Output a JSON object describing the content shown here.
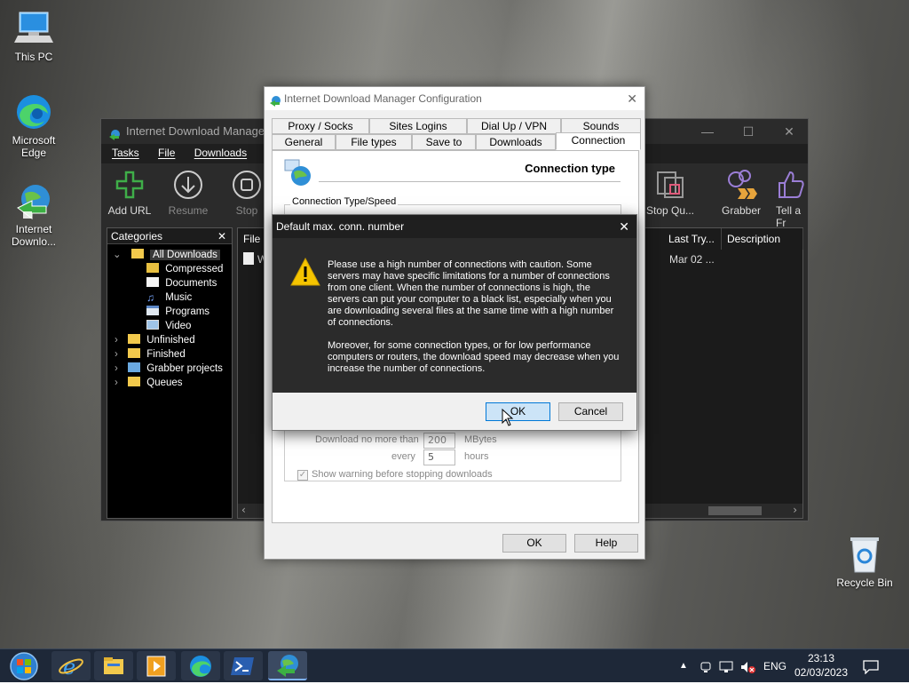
{
  "desktop": {
    "icons": [
      {
        "label": "This PC"
      },
      {
        "label": "Microsoft Edge"
      },
      {
        "label": "Internet Downlo..."
      },
      {
        "label": "Recycle Bin"
      }
    ]
  },
  "main_window": {
    "title": "Internet Download Manager 6",
    "menu": [
      "Tasks",
      "File",
      "Downloads"
    ],
    "toolbar": {
      "add_url": "Add URL",
      "resume": "Resume",
      "stop": "Stop",
      "stop_queue": "Stop Qu...",
      "grabber": "Grabber",
      "tell_friend": "Tell a Fr"
    },
    "categories": {
      "header": "Categories",
      "items": [
        "All Downloads",
        "Compressed",
        "Documents",
        "Music",
        "Programs",
        "Video",
        "Unfinished",
        "Finished",
        "Grabber projects",
        "Queues"
      ]
    },
    "file_list": {
      "columns": [
        "File N",
        "Last Try...",
        "Description"
      ],
      "rows": [
        {
          "name": "W",
          "last_try": "Mar 02 ..."
        }
      ]
    }
  },
  "config_dialog": {
    "title": "Internet Download Manager Configuration",
    "tabs_row1": [
      "Proxy / Socks",
      "Sites Logins",
      "Dial Up / VPN",
      "Sounds"
    ],
    "tabs_row2": [
      "General",
      "File types",
      "Save to",
      "Downloads",
      "Connection"
    ],
    "active_tab": "Connection",
    "section_title": "Connection type",
    "group_label": "Connection Type/Speed",
    "download_limit_label": "Download no more than",
    "download_limit_value": "200",
    "download_limit_unit": "MBytes",
    "every_label": "every",
    "every_value": "5",
    "every_unit": "hours",
    "show_warning_label": "Show warning before stopping downloads",
    "ok": "OK",
    "help": "Help"
  },
  "alert_dialog": {
    "title": "Default max. conn. number",
    "message_1": "Please use a high number of connections with caution. Some servers may have specific limitations for a number of connections from one client. When the number of connections is high, the servers can put your computer to a black list, especially when you are downloading several files at the same time with a high number of connections.",
    "message_2": "Moreover, for some connection types, or for low performance computers or routers, the download speed may decrease when you increase the number of connections.",
    "ok": "OK",
    "cancel": "Cancel"
  },
  "taskbar": {
    "language": "ENG",
    "time": "23:13",
    "date": "02/03/2023"
  },
  "colors": {
    "accent": "#0078d7",
    "ok_focus": "#cce4f7",
    "dark_bg": "#2b2b2b",
    "warning": "#f5c400"
  }
}
